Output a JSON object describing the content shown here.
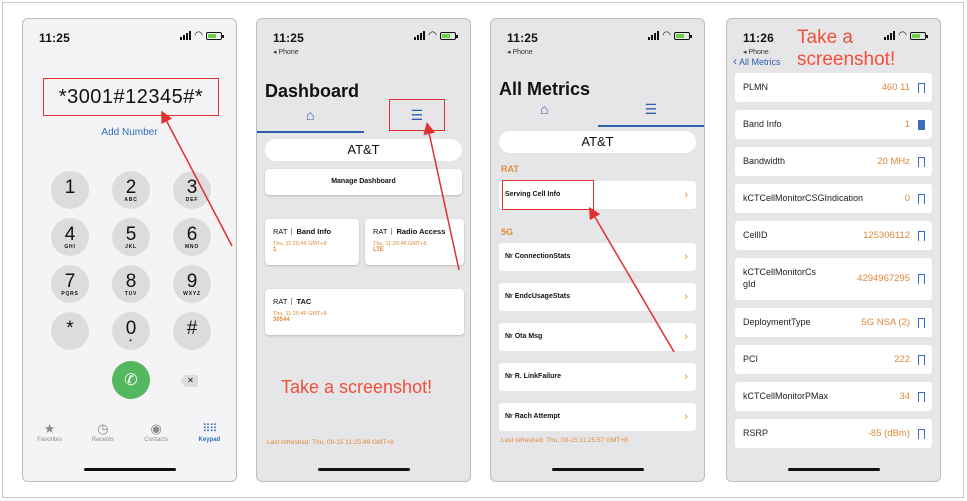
{
  "status": {
    "carrier_back": "◂ Phone"
  },
  "phone1": {
    "time": "11:25",
    "dialed_number": "*3001#12345#*",
    "add_number": "Add Number",
    "keys": [
      {
        "digit": "1",
        "letters": ""
      },
      {
        "digit": "2",
        "letters": "ABC"
      },
      {
        "digit": "3",
        "letters": "DEF"
      },
      {
        "digit": "4",
        "letters": "GHI"
      },
      {
        "digit": "5",
        "letters": "JKL"
      },
      {
        "digit": "6",
        "letters": "MNO"
      },
      {
        "digit": "7",
        "letters": "PQRS"
      },
      {
        "digit": "8",
        "letters": "TUV"
      },
      {
        "digit": "9",
        "letters": "WXYZ"
      },
      {
        "digit": "*",
        "letters": ""
      },
      {
        "digit": "0",
        "letters": "+"
      },
      {
        "digit": "#",
        "letters": ""
      }
    ],
    "tabs": [
      {
        "label": "Favorites",
        "icon": "star-icon"
      },
      {
        "label": "Recents",
        "icon": "clock-icon"
      },
      {
        "label": "Contacts",
        "icon": "person-icon"
      },
      {
        "label": "Keypad",
        "icon": "keypad-icon",
        "active": true
      }
    ]
  },
  "phone2": {
    "time": "11:25",
    "back": "◂ Phone",
    "title": "Dashboard",
    "carrier": "AT&T",
    "manage": "Manage Dashboard",
    "cards": [
      {
        "rat": "RAT",
        "name": "Band Info",
        "ts": "Thu, 11:25:46 GMT+8",
        "value": "1"
      },
      {
        "rat": "RAT",
        "name": "Radio Access",
        "ts": "Thu, 11:25:46 GMT+8",
        "value": "LTE"
      },
      {
        "rat": "RAT",
        "name": "TAC",
        "ts": "Thu, 11:25:46 GMT+8",
        "value": "30544"
      }
    ],
    "annotation": "Take a screenshot!",
    "refreshed": "Last refreshed: Thu, 09-15 11:25:49 GMT+8"
  },
  "phone3": {
    "time": "11:25",
    "back": "◂ Phone",
    "title": "All Metrics",
    "carrier": "AT&T",
    "sections": [
      {
        "header": "RAT",
        "rows": [
          "Serving Cell Info"
        ]
      },
      {
        "header": "5G",
        "rows": [
          "Nr ConnectionStats",
          "Nr EndcUsageStats",
          "Nr Ota Msg",
          "Nr R. LinkFailure",
          "Nr Rach Attempt"
        ]
      }
    ],
    "refreshed": "Last refreshed: Thu, 09-15 11:25:57 GMT+8"
  },
  "phone4": {
    "time": "11:26",
    "back": "◂ Phone",
    "nav_back": "All Metrics",
    "annotation_line1": "Take a",
    "annotation_line2": "screenshot!",
    "rows": [
      {
        "label": "PLMN",
        "value": "460 11",
        "bookmarked": false
      },
      {
        "label": "Band Info",
        "value": "1",
        "bookmarked": true
      },
      {
        "label": "Bandwidth",
        "value": "20 MHz",
        "bookmarked": false
      },
      {
        "label": "kCTCellMonitorCSGIndication",
        "value": "0",
        "bookmarked": false
      },
      {
        "label": "CellID",
        "value": "125306112",
        "bookmarked": false
      },
      {
        "label": "kCTCellMonitorCsgId",
        "label_line1": "kCTCellMonitorCs",
        "label_line2": "gId",
        "value": "4294967295",
        "bookmarked": false
      },
      {
        "label": "DeploymentType",
        "value": "5G NSA (2)",
        "bookmarked": false
      },
      {
        "label": "PCI",
        "value": "222",
        "bookmarked": false
      },
      {
        "label": "kCTCellMonitorPMax",
        "value": "34",
        "bookmarked": false
      },
      {
        "label": "RSRP",
        "value": "-85 (dBm)",
        "bookmarked": false
      }
    ]
  },
  "colors": {
    "accent": "#2f5fa8",
    "orange": "#e0893a",
    "annotation_red": "#e03030",
    "call_green": "#53b85f"
  }
}
